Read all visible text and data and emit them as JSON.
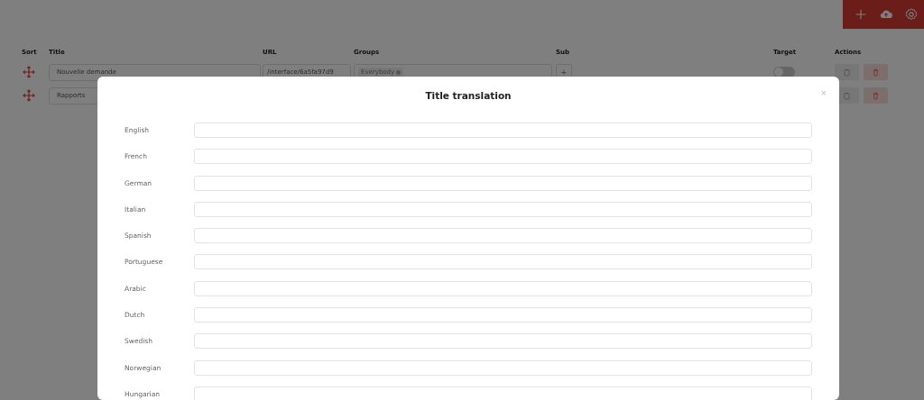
{
  "toolbar": {
    "buttons": [
      {
        "kind": "add"
      },
      {
        "kind": "upload"
      },
      {
        "kind": "settings"
      }
    ]
  },
  "table": {
    "columns": [
      "Sort",
      "Title",
      "URL",
      "Groups",
      "Sub",
      "Target",
      "Actions"
    ],
    "rows": [
      {
        "title": "Nouvelle demande",
        "url": "/interface/6a5fa97d9",
        "groups": [
          "Everybody"
        ],
        "sub": "+",
        "target": {
          "on": false
        }
      },
      {
        "title": "Rapports"
      }
    ]
  },
  "modal": {
    "title": "Title translation",
    "close": "×",
    "fields": [
      {
        "label": "English"
      },
      {
        "label": "French"
      },
      {
        "label": "German"
      },
      {
        "label": "Italian"
      },
      {
        "label": "Spanish"
      },
      {
        "label": "Portuguese"
      },
      {
        "label": "Arabic"
      },
      {
        "label": "Dutch"
      },
      {
        "label": "Swedish"
      },
      {
        "label": "Norwegian"
      },
      {
        "label": "Hungarian"
      }
    ]
  }
}
